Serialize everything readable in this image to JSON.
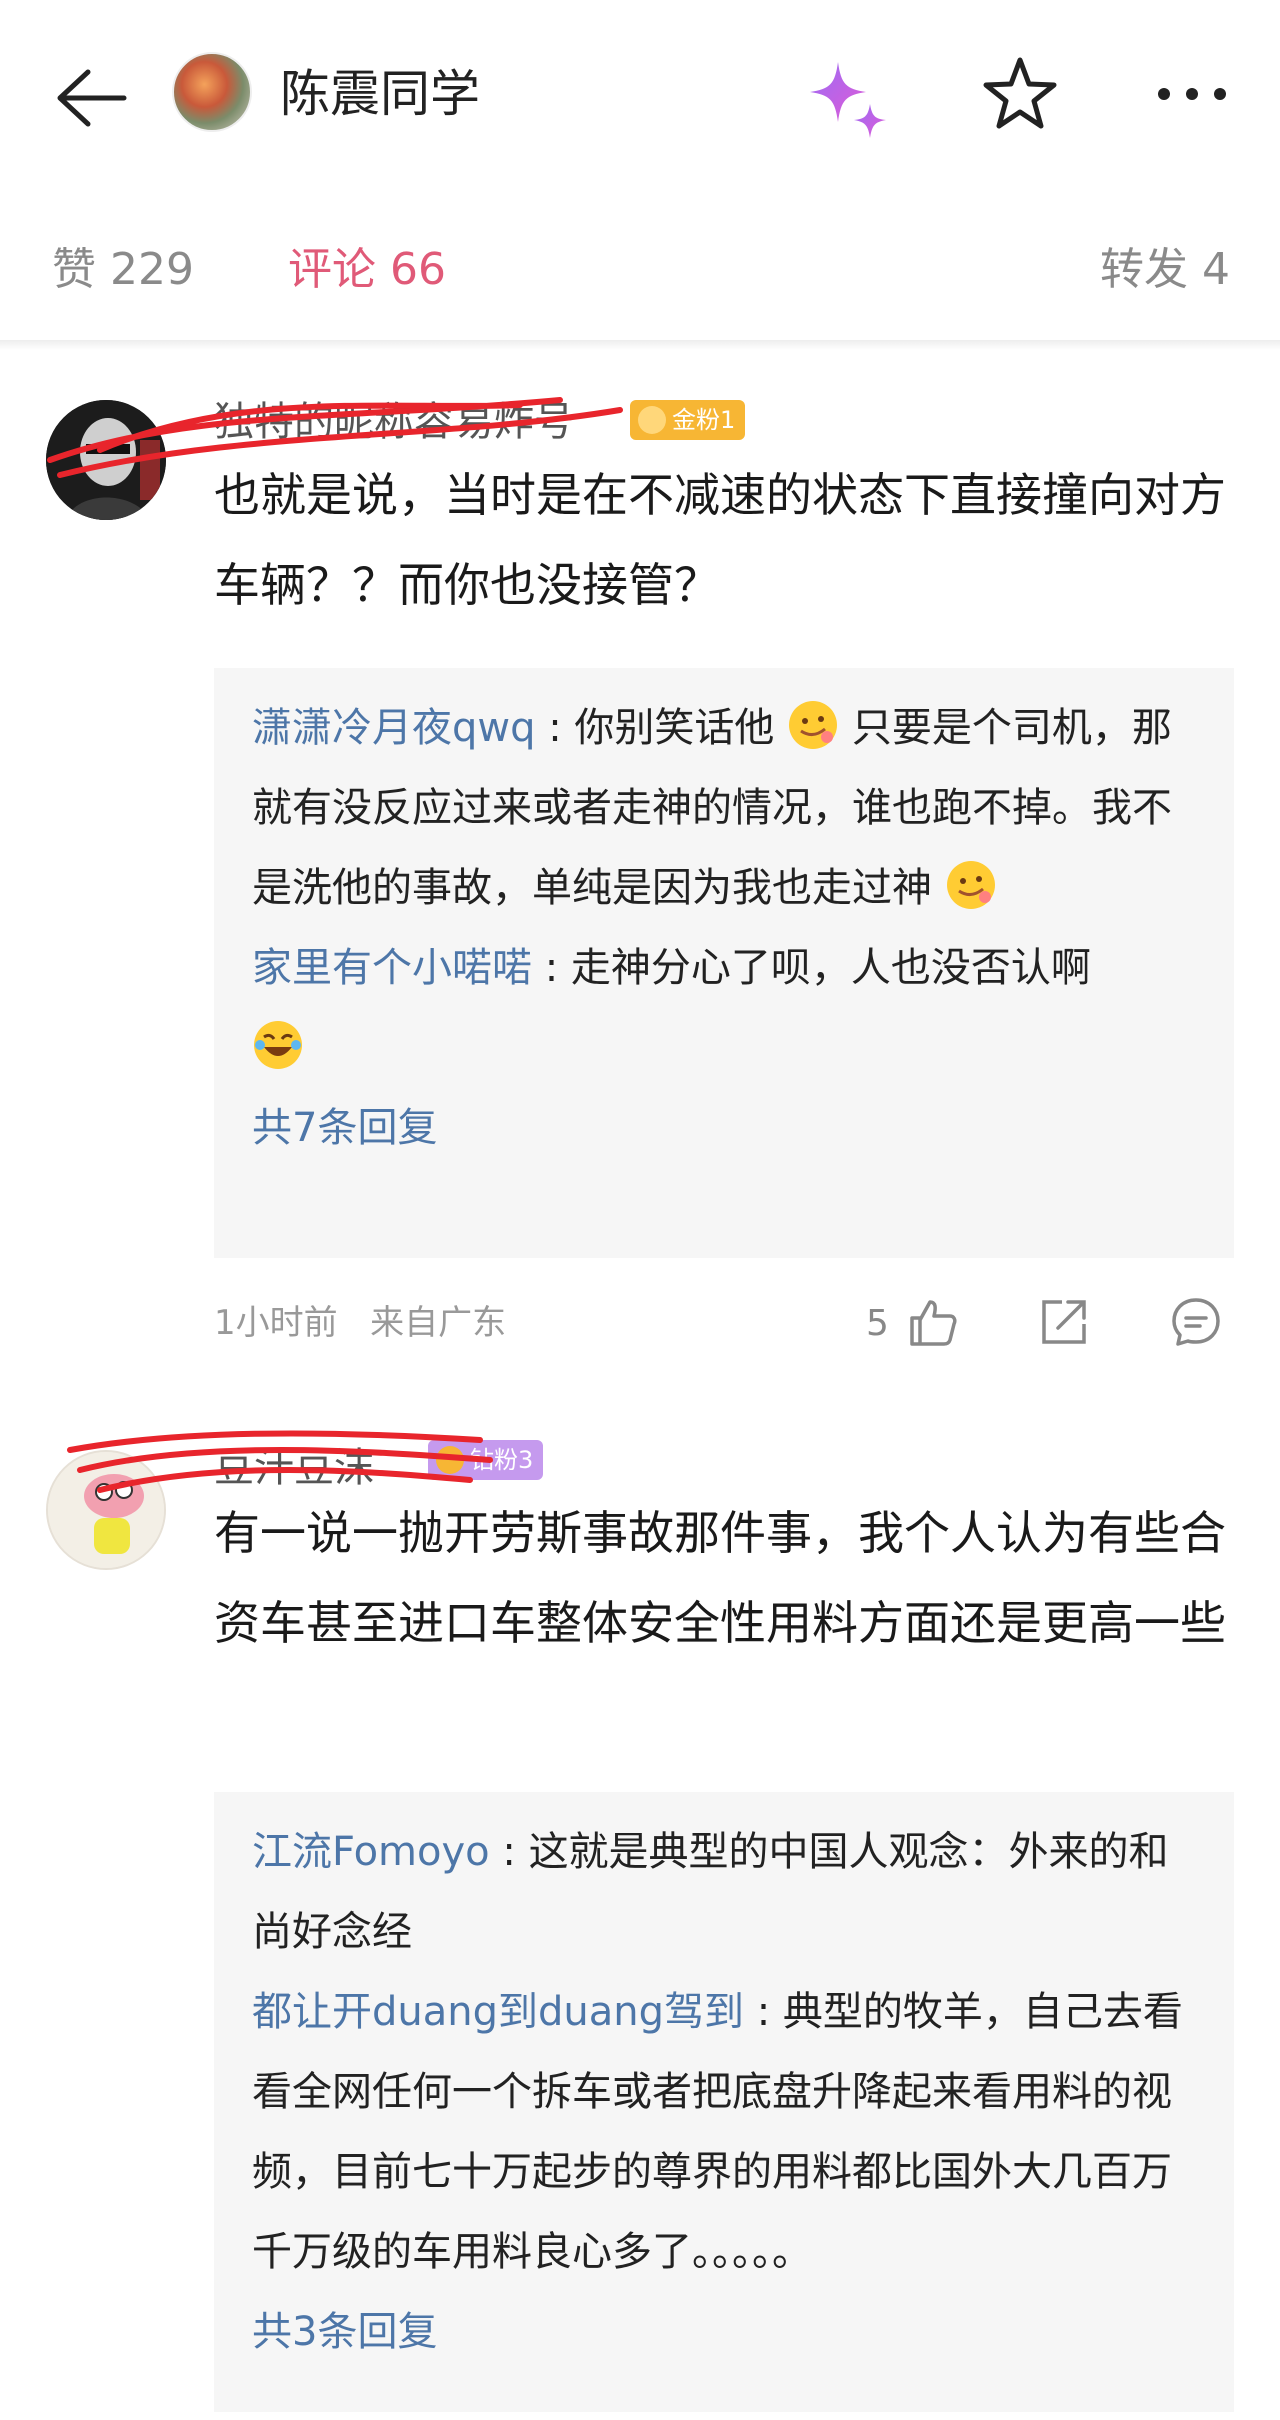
{
  "header": {
    "title": "陈震同学",
    "icons": {
      "back": "back-arrow-icon",
      "sparkle": "sparkle-icon",
      "favorite": "star-icon",
      "more": "more-dots-icon"
    }
  },
  "tabs": {
    "likes": "赞 229",
    "comments": "评论 66",
    "reposts": "转发 4"
  },
  "comments": [
    {
      "name": "独特的昵称容易炸号",
      "badge": "金粉1",
      "badge_color": "#f7b634",
      "text": "也就是说，当时是在不减速的状态下直接撞向对方车辆？？而你也没接管？",
      "replies": [
        {
          "name": "潇潇冷月夜qwq",
          "text_a": "你别笑话他",
          "text_b": "只要是个司机，那就有没反应过来或者走神的情况，谁也跑不掉。我不是洗他的事故，单纯是因为我也走过神"
        },
        {
          "name": "家里有个小喏喏",
          "text_a": "走神分心了呗，人也没否认啊",
          "text_b": ""
        }
      ],
      "more_replies": "共7条回复",
      "time": "1小时前",
      "location": "来自广东",
      "like_count": "5"
    },
    {
      "name": "豆汁豆沫",
      "badge": "钻粉3",
      "badge_color": "#c59aee",
      "text": "有一说一抛开劳斯事故那件事，我个人认为有些合资车甚至进口车整体安全性用料方面还是更高一些",
      "replies": [
        {
          "name": "江流Fomoyo",
          "text_a": "这就是典型的中国人观念：外来的和尚好念经"
        },
        {
          "name": "都让开duang到duang驾到",
          "text_a": "典型的牧羊，自己去看看全网任何一个拆车或者把底盘升降起来看用料的视频，目前七十万起步的尊界的用料都比国外大几百万 千万级的车用料良心多了。。。。。"
        }
      ],
      "more_replies": "共3条回复"
    }
  ]
}
